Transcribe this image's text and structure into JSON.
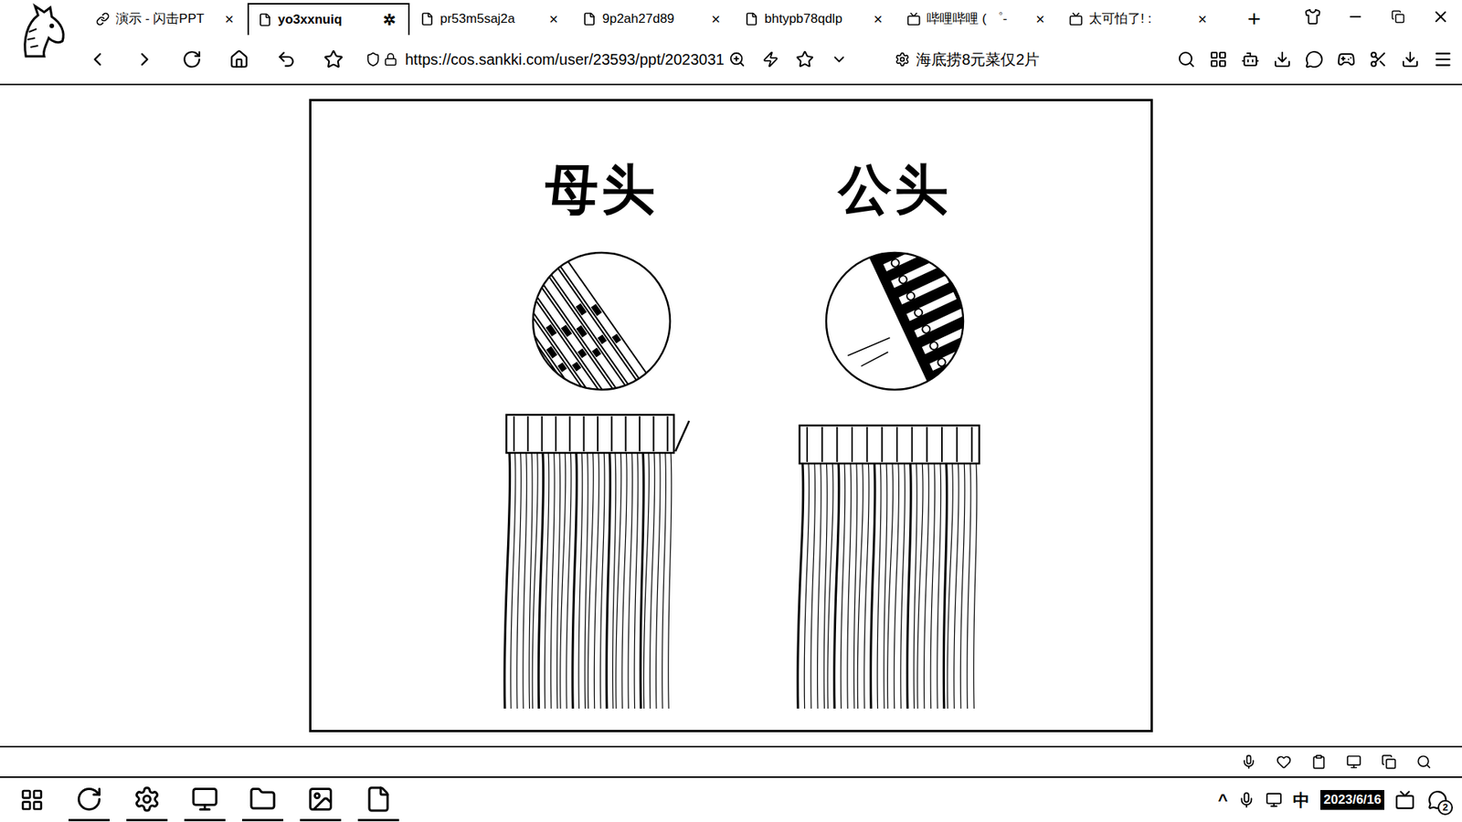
{
  "browser": {
    "tabs": [
      {
        "label": "演示 - 闪击PPT",
        "selected": false,
        "kind": "link",
        "close": "×"
      },
      {
        "label": "yo3xxnuiq",
        "selected": true,
        "kind": "page",
        "close": "✲"
      },
      {
        "label": "pr53m5saj2a",
        "selected": false,
        "kind": "page",
        "close": "×"
      },
      {
        "label": "9p2ah27d89",
        "selected": false,
        "kind": "page",
        "close": "×"
      },
      {
        "label": "bhtypb78qdlp",
        "selected": false,
        "kind": "page",
        "close": "×"
      },
      {
        "label": "哔哩哔哩 ( ゜-",
        "selected": false,
        "kind": "tv",
        "close": "×"
      },
      {
        "label": "太可怕了! :",
        "selected": false,
        "kind": "tv",
        "close": "×"
      }
    ],
    "new_tab": "+",
    "url": "https://cos.sankki.com/user/23593/ppt/2023031",
    "hot_search": "海底捞8元菜仅2片"
  },
  "slide": {
    "columns": [
      {
        "title": "母头",
        "kind": "female"
      },
      {
        "title": "公头",
        "kind": "male"
      }
    ]
  },
  "taskbar": {
    "tray_arrow": "^",
    "ime": "中",
    "date": "2023/6/16",
    "badge": "2"
  }
}
